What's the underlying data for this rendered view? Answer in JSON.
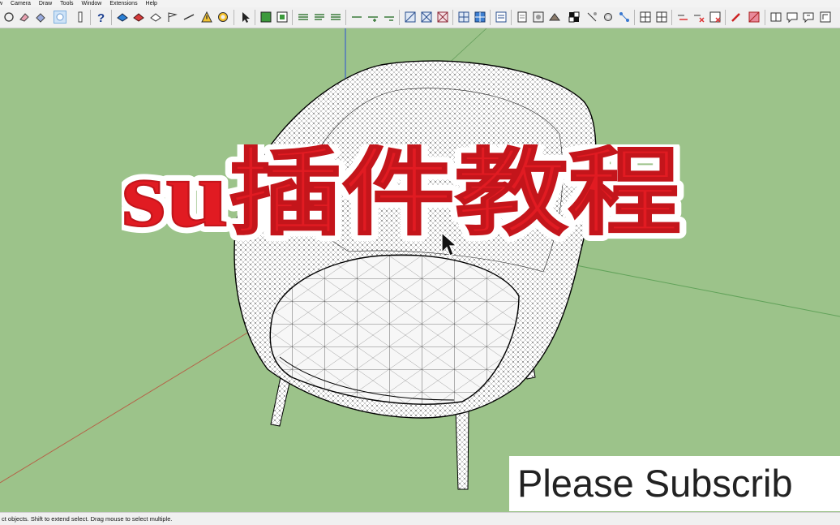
{
  "menubar": {
    "items": [
      "w",
      "Camera",
      "Draw",
      "Tools",
      "Window",
      "Extensions",
      "Help"
    ]
  },
  "toolbar": {
    "icons": [
      "circle-icon",
      "eraser-icon",
      "paint-bucket-icon",
      "select-icon",
      "push-pull-icon",
      "help-icon",
      "ruler-icon",
      "tape-icon",
      "warning-icon",
      "undo-icon",
      "cursor-icon",
      "grid-icon",
      "layers-icon",
      "list-icon",
      "axis-icon",
      "shape-icon",
      "texture-icon",
      "camera-icon",
      "checker-icon",
      "gear-icon",
      "section-icon"
    ]
  },
  "overlay": {
    "title": "su插件教程",
    "subscribe": "Please Subscrib"
  },
  "status": {
    "text": "ct objects. Shift to extend select. Drag mouse to select multiple."
  },
  "colors": {
    "background": "#9cc38a",
    "title_red": "#e11b22",
    "toolbar_bg": "#f0f0f0"
  }
}
